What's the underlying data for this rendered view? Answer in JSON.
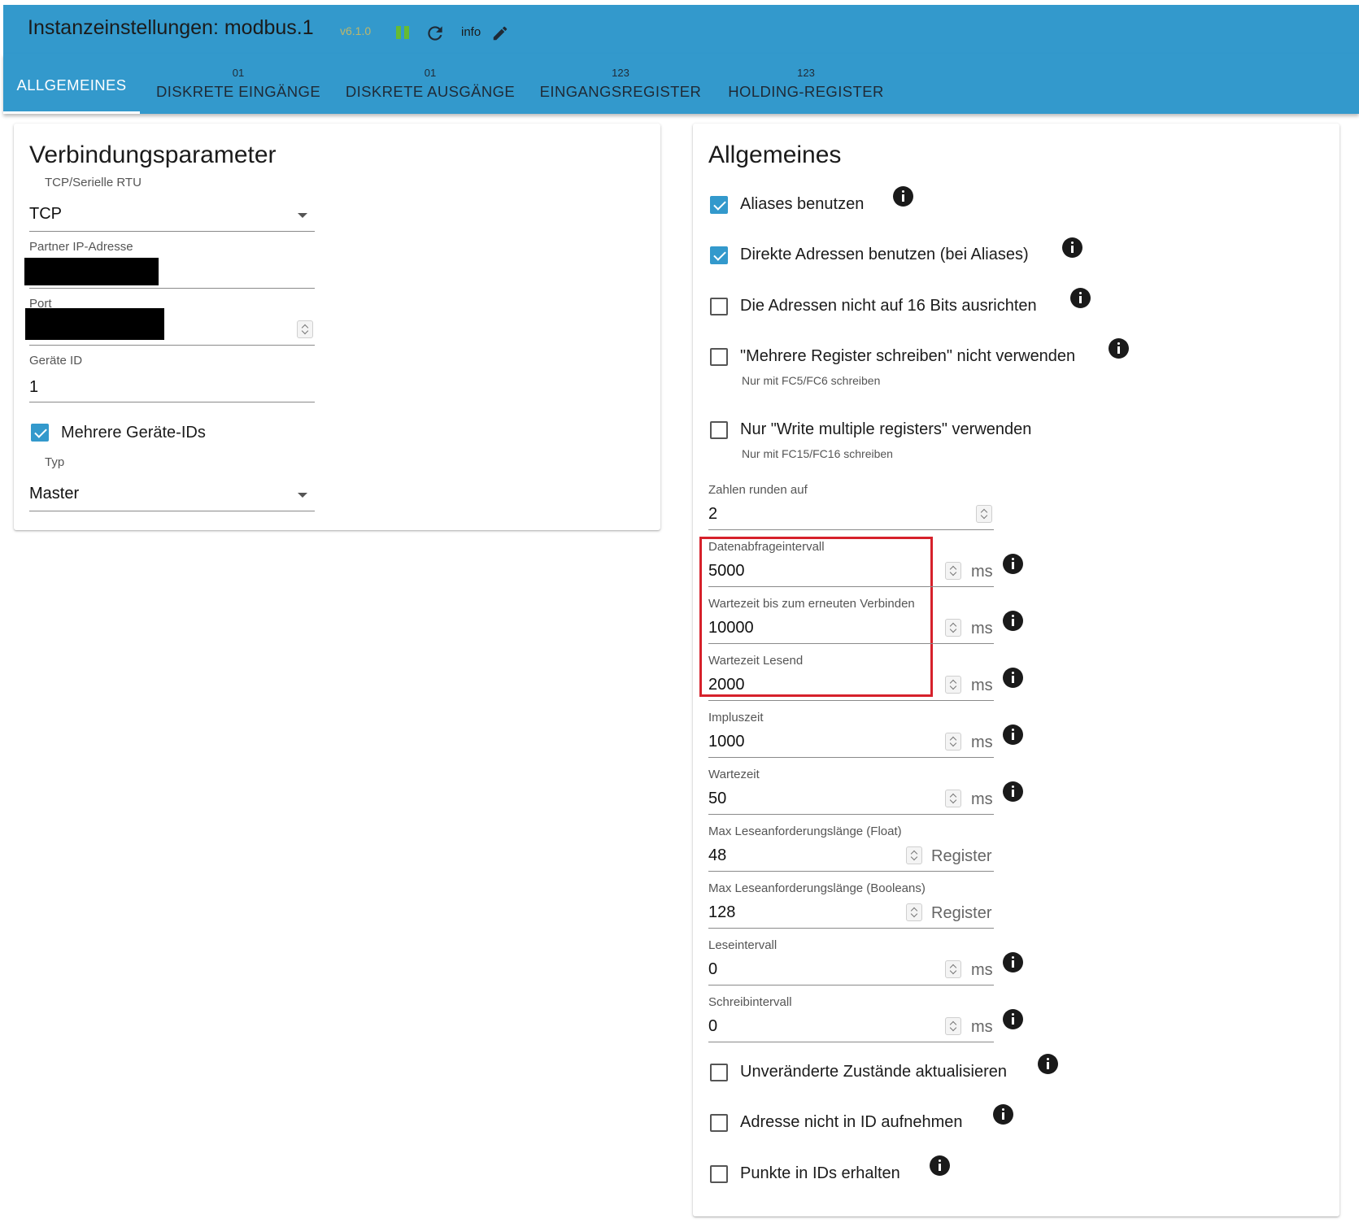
{
  "header": {
    "title": "Instanzeinstellungen: modbus.1",
    "version": "v6.1.0",
    "info_label": "info",
    "pause_icon": "pause-icon",
    "refresh_icon": "refresh-icon",
    "edit_icon": "pencil-icon"
  },
  "tabs": [
    {
      "label": "ALLGEMEINES",
      "sub": "",
      "active": true
    },
    {
      "label": "DISKRETE EINGÄNGE",
      "sub": "01"
    },
    {
      "label": "DISKRETE AUSGÄNGE",
      "sub": "01"
    },
    {
      "label": "EINGANGSREGISTER",
      "sub": "123"
    },
    {
      "label": "HOLDING-REGISTER",
      "sub": "123"
    }
  ],
  "connection": {
    "title": "Verbindungsparameter",
    "type_label": "TCP/Serielle RTU",
    "type_value": "TCP",
    "ip_label": "Partner IP-Adresse",
    "port_label": "Port",
    "device_id_label": "Geräte ID",
    "device_id_value": "1",
    "multi_ids_label": "Mehrere Geräte-IDs",
    "multi_ids_checked": true,
    "role_label": "Typ",
    "role_value": "Master"
  },
  "general": {
    "title": "Allgemeines",
    "checkboxes_top": [
      {
        "label": "Aliases benutzen",
        "checked": true,
        "help": ""
      },
      {
        "label": "Direkte Adressen benutzen (bei Aliases)",
        "checked": true,
        "help": ""
      },
      {
        "label": "Die Adressen nicht auf 16 Bits ausrichten",
        "checked": false,
        "help": ""
      },
      {
        "label": "\"Mehrere Register schreiben\" nicht verwenden",
        "checked": false,
        "help": "Nur mit FC5/FC6 schreiben"
      },
      {
        "label": "Nur \"Write multiple registers\" verwenden",
        "checked": false,
        "help": "Nur mit FC15/FC16 schreiben"
      }
    ],
    "fields": [
      {
        "label": "Zahlen runden auf",
        "value": "2",
        "unit": ""
      },
      {
        "label": "Datenabfrageintervall",
        "value": "5000",
        "unit": "ms"
      },
      {
        "label": "Wartezeit bis zum erneuten Verbinden",
        "value": "10000",
        "unit": "ms"
      },
      {
        "label": "Wartezeit Lesend",
        "value": "2000",
        "unit": "ms"
      },
      {
        "label": "Impluszeit",
        "value": "1000",
        "unit": "ms"
      },
      {
        "label": "Wartezeit",
        "value": "50",
        "unit": "ms"
      },
      {
        "label": "Max Leseanforderungslänge (Float)",
        "value": "48",
        "unit": "Register"
      },
      {
        "label": "Max Leseanforderungslänge (Booleans)",
        "value": "128",
        "unit": "Register"
      },
      {
        "label": "Leseintervall",
        "value": "0",
        "unit": "ms"
      },
      {
        "label": "Schreibintervall",
        "value": "0",
        "unit": "ms"
      }
    ],
    "checkboxes_bottom": [
      {
        "label": "Unveränderte Zustände aktualisieren",
        "checked": false
      },
      {
        "label": "Adresse nicht in ID aufnehmen",
        "checked": false
      },
      {
        "label": "Punkte in IDs erhalten",
        "checked": false
      }
    ]
  },
  "colors": {
    "header": "#3399cc",
    "checkbox_on": "#3399cc",
    "highlight": "#d6212b",
    "version": "#bdb76b",
    "pause": "#66bb33"
  }
}
